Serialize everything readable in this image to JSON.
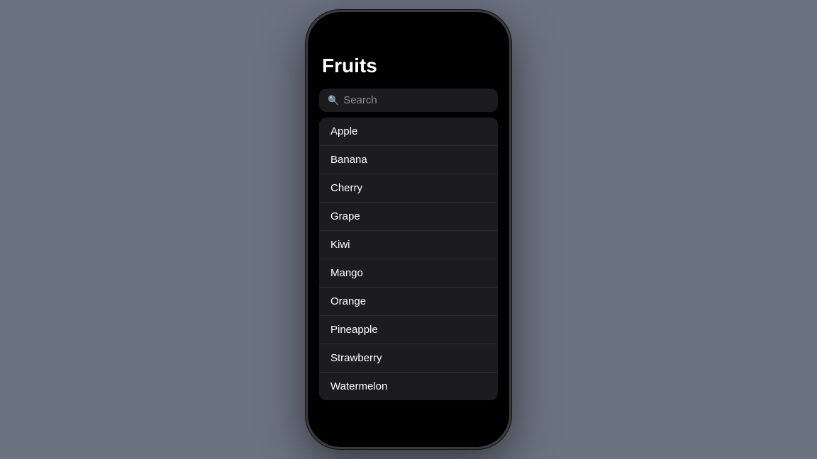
{
  "app": {
    "title": "Fruits",
    "background_color": "#6b7280"
  },
  "search": {
    "placeholder": "Search",
    "value": ""
  },
  "fruits": [
    {
      "id": 1,
      "name": "Apple"
    },
    {
      "id": 2,
      "name": "Banana"
    },
    {
      "id": 3,
      "name": "Cherry"
    },
    {
      "id": 4,
      "name": "Grape"
    },
    {
      "id": 5,
      "name": "Kiwi"
    },
    {
      "id": 6,
      "name": "Mango"
    },
    {
      "id": 7,
      "name": "Orange"
    },
    {
      "id": 8,
      "name": "Pineapple"
    },
    {
      "id": 9,
      "name": "Strawberry"
    },
    {
      "id": 10,
      "name": "Watermelon"
    }
  ]
}
